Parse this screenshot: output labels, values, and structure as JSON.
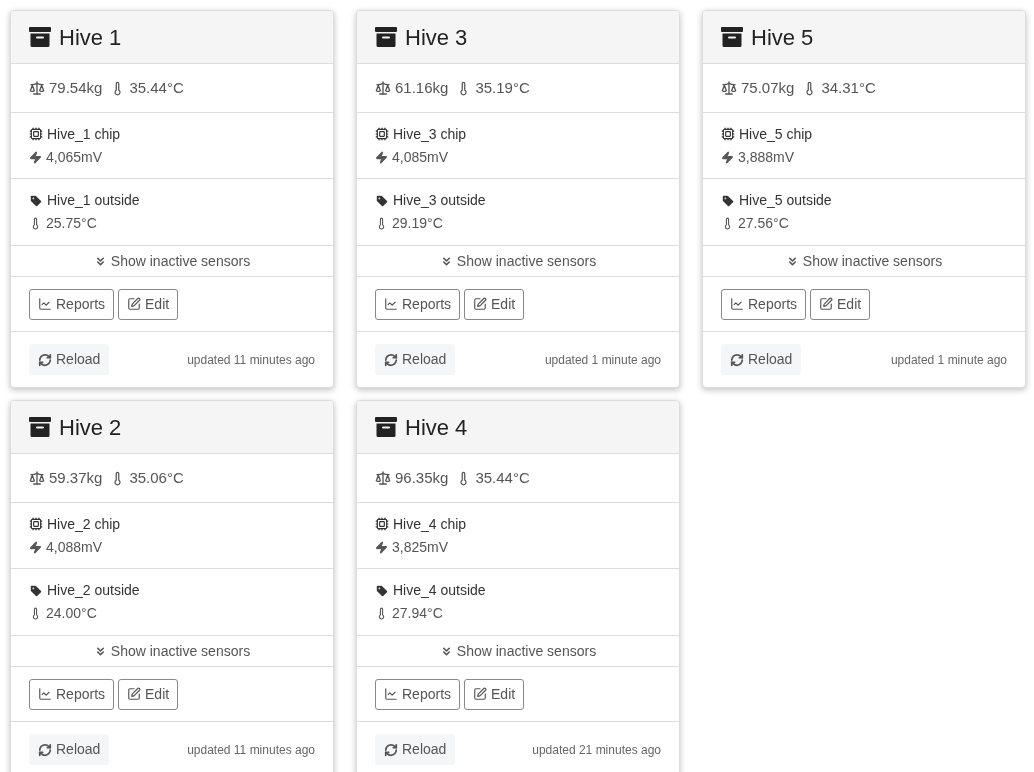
{
  "hives": [
    {
      "title": "Hive 1",
      "weight": "79.54kg",
      "temperature": "35.44°C",
      "chip": {
        "name": "Hive_1 chip",
        "voltage": "4,065mV"
      },
      "outside": {
        "name": "Hive_1 outside",
        "temperature": "25.75°C"
      },
      "toggle": "Show inactive sensors",
      "buttons": [
        "Reports",
        "Edit"
      ],
      "reload": "Reload",
      "updated": "updated 11 minutes ago"
    },
    {
      "title": "Hive 3",
      "weight": "61.16kg",
      "temperature": "35.19°C",
      "chip": {
        "name": "Hive_3 chip",
        "voltage": "4,085mV"
      },
      "outside": {
        "name": "Hive_3 outside",
        "temperature": "29.19°C"
      },
      "toggle": "Show inactive sensors",
      "buttons": [
        "Reports",
        "Edit"
      ],
      "reload": "Reload",
      "updated": "updated 1 minute ago"
    },
    {
      "title": "Hive 5",
      "weight": "75.07kg",
      "temperature": "34.31°C",
      "chip": {
        "name": "Hive_5 chip",
        "voltage": "3,888mV"
      },
      "outside": {
        "name": "Hive_5 outside",
        "temperature": "27.56°C"
      },
      "toggle": "Show inactive sensors",
      "buttons": [
        "Reports",
        "Edit"
      ],
      "reload": "Reload",
      "updated": "updated 1 minute ago"
    },
    {
      "title": "Hive 2",
      "weight": "59.37kg",
      "temperature": "35.06°C",
      "chip": {
        "name": "Hive_2 chip",
        "voltage": "4,088mV"
      },
      "outside": {
        "name": "Hive_2 outside",
        "temperature": "24.00°C"
      },
      "toggle": "Show inactive sensors",
      "buttons": [
        "Reports",
        "Edit"
      ],
      "reload": "Reload",
      "updated": "updated 11 minutes ago"
    },
    {
      "title": "Hive 4",
      "weight": "96.35kg",
      "temperature": "35.44°C",
      "chip": {
        "name": "Hive_4 chip",
        "voltage": "3,825mV"
      },
      "outside": {
        "name": "Hive_4 outside",
        "temperature": "27.94°C"
      },
      "toggle": "Show inactive sensors",
      "buttons": [
        "Reports",
        "Edit"
      ],
      "reload": "Reload",
      "updated": "updated 21 minutes ago"
    }
  ]
}
